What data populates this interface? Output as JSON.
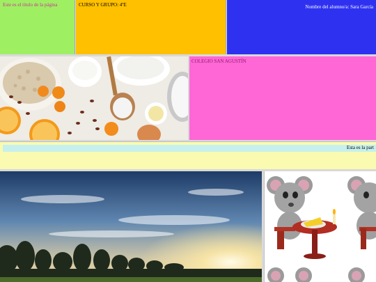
{
  "header": {
    "page_title_text": "Este es el título de la página",
    "course_text": "CURSO Y GRUPO: 4ºE",
    "student_text": "Nombre del alumno/a: Sara García"
  },
  "school": {
    "name": "COLEGIO SAN AGUSTÍN"
  },
  "marquee": {
    "text": "Esta es la part"
  },
  "colors": {
    "title_bg": "#9ef062",
    "course_bg": "#ffc000",
    "student_bg": "#2e32f0",
    "school_bg": "#ff66d6",
    "marquee_bg": "#fafab0",
    "marquee_bar": "#c6f0ee"
  }
}
